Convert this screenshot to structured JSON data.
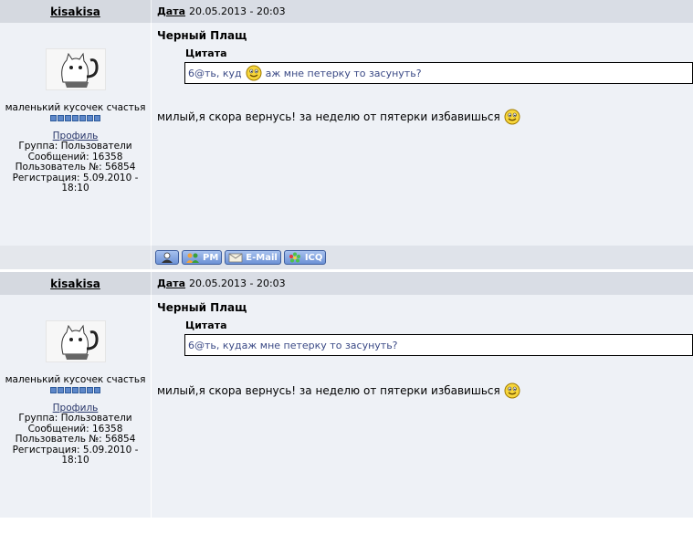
{
  "posts": [
    {
      "author": "kisakisa",
      "date_label": "Дата",
      "date": "20.05.2013 - 20:03",
      "user_title": "маленький кусочек счастья",
      "rank_pips": 7,
      "profile_link": "Профиль",
      "group": "Группа: Пользователи",
      "messages": "Сообщений: 16358",
      "user_number": "Пользователь №: 56854",
      "registration_1": "Регистрация: 5.09.2010 -",
      "registration_2": "18:10",
      "post_author": "Черный Плащ",
      "quote_label": "Цитата",
      "quote_before": "6@ть, куд",
      "quote_after": "аж мне петерку то засунуть?",
      "message": "милый,я скора вернусь! за неделю от пятерки избавишься",
      "buttons": {
        "pm": "PM",
        "email": "E-Mail",
        "icq": "ICQ"
      }
    },
    {
      "author": "kisakisa",
      "date_label": "Дата",
      "date": "20.05.2013 - 20:03",
      "user_title": "маленький кусочек счастья",
      "rank_pips": 7,
      "profile_link": "Профиль",
      "group": "Группа: Пользователи",
      "messages": "Сообщений: 16358",
      "user_number": "Пользователь №: 56854",
      "registration_1": "Регистрация: 5.09.2010 -",
      "registration_2": "18:10",
      "post_author": "Черный Плащ",
      "quote_label": "Цитата",
      "quote": "6@ть, кудаж мне петерку то засунуть?",
      "message": "милый,я скора вернусь! за неделю от пятерки избавишься"
    }
  ],
  "colors": {
    "link": "#28366a",
    "quote_text": "#3b4a86",
    "button": "#6d92d6"
  }
}
